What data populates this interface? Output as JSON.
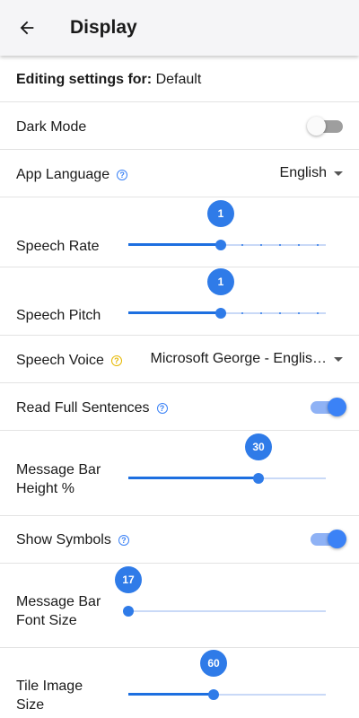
{
  "appbar": {
    "title": "Display",
    "back_icon": "arrow-left-icon"
  },
  "editing": {
    "prefix": "Editing settings for:",
    "value": "Default"
  },
  "dark_mode": {
    "label": "Dark Mode",
    "on": false
  },
  "app_language": {
    "label": "App Language",
    "value": "English"
  },
  "speech_rate": {
    "label": "Speech Rate",
    "value": "1",
    "fraction": 0.47
  },
  "speech_pitch": {
    "label": "Speech Pitch",
    "value": "1",
    "fraction": 0.47
  },
  "speech_voice": {
    "label": "Speech Voice",
    "value": "Microsoft George - Englis…"
  },
  "read_full_sentences": {
    "label": "Read Full Sentences",
    "on": true
  },
  "message_bar_height": {
    "label_line1": "Message Bar",
    "label_line2": "Height %",
    "value": "30",
    "fraction": 0.66
  },
  "show_symbols": {
    "label": "Show Symbols",
    "on": true
  },
  "message_bar_font_size": {
    "label_line1": "Message Bar",
    "label_line2": "Font Size",
    "value": "17",
    "fraction": 0.0
  },
  "tile_image_size": {
    "label_line1": "Tile Image",
    "label_line2": "Size",
    "value": "60",
    "fraction": 0.43
  },
  "colors": {
    "accent": "#2f7be8",
    "accent_light": "#8fb2f5",
    "help_icon": "#3b82f6",
    "warn_icon": "#e6b800"
  }
}
